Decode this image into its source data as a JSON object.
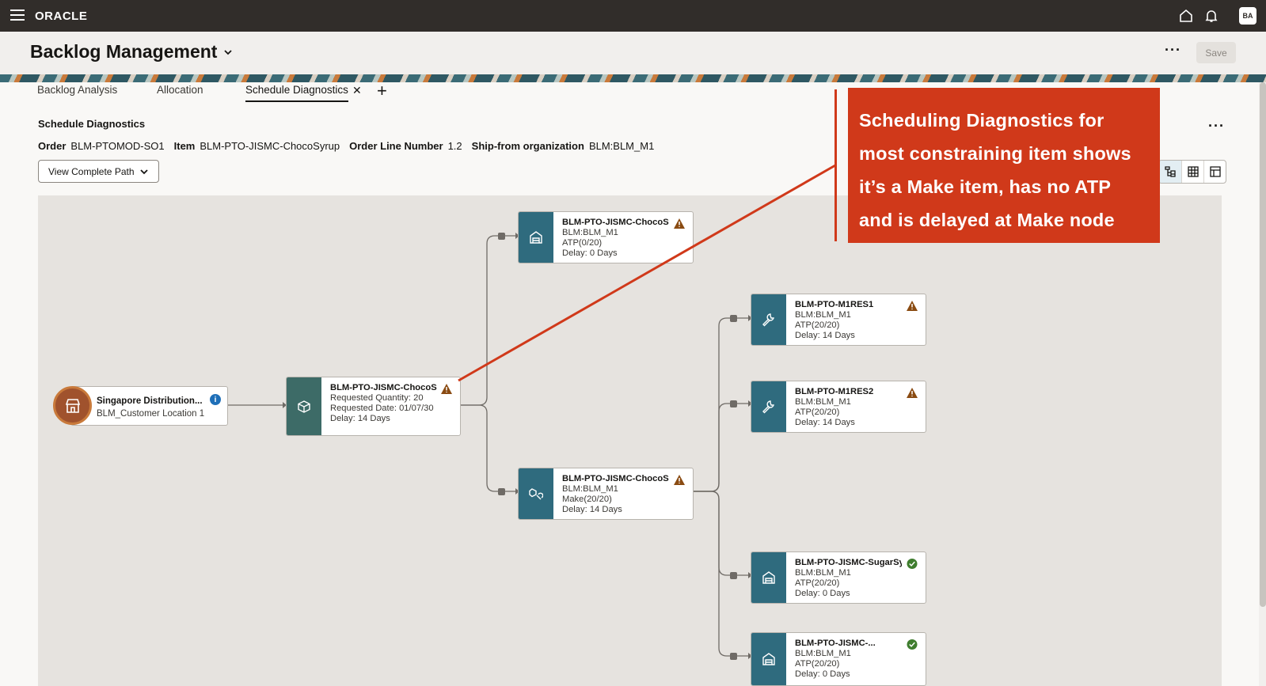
{
  "header": {
    "brand": "ORACLE",
    "avatar_initials": "BA"
  },
  "page": {
    "title": "Backlog Management",
    "save_label": "Save"
  },
  "tabs": [
    {
      "label": "Backlog Analysis"
    },
    {
      "label": "Allocation"
    },
    {
      "label": "Schedule Diagnostics"
    }
  ],
  "diagnostics": {
    "title": "Schedule Diagnostics",
    "order_label": "Order",
    "order_value": "BLM-PTOMOD-SO1",
    "item_label": "Item",
    "item_value": "BLM-PTO-JISMC-ChocoSyrup",
    "line_label": "Order Line Number",
    "line_value": "1.2",
    "org_label": "Ship-from organization",
    "org_value": "BLM:BLM_M1",
    "view_button": "View Complete Path"
  },
  "customer_node": {
    "name": "Singapore Distribution...",
    "location": "BLM_Customer Location 1"
  },
  "root_node": {
    "name": "BLM-PTO-JISMC-ChocoSyrup",
    "l1": "Requested Quantity: 20",
    "l2": "Requested Date: 01/07/30",
    "l3": "Delay: 14 Days",
    "status": "warning"
  },
  "nodes": [
    {
      "name": "BLM-PTO-JISMC-ChocoSyrup",
      "l1": "BLM:BLM_M1",
      "l2": "ATP(0/20)",
      "l3": "Delay: 0 Days",
      "status": "warning",
      "icon": "warehouse-icon"
    },
    {
      "name": "BLM-PTO-JISMC-ChocoSyrup",
      "l1": "BLM:BLM_M1",
      "l2": "Make(20/20)",
      "l3": "Delay: 14 Days",
      "status": "warning",
      "icon": "make-icon"
    },
    {
      "name": "BLM-PTO-M1RES1",
      "l1": "BLM:BLM_M1",
      "l2": "ATP(20/20)",
      "l3": "Delay: 14 Days",
      "status": "warning",
      "icon": "wrench-icon"
    },
    {
      "name": "BLM-PTO-M1RES2",
      "l1": "BLM:BLM_M1",
      "l2": "ATP(20/20)",
      "l3": "Delay: 14 Days",
      "status": "warning",
      "icon": "wrench-icon"
    },
    {
      "name": "BLM-PTO-JISMC-SugarSyrup",
      "l1": "BLM:BLM_M1",
      "l2": "ATP(20/20)",
      "l3": "Delay: 0 Days",
      "status": "ok",
      "icon": "warehouse-icon"
    },
    {
      "name": "BLM-PTO-JISMC-...",
      "l1": "BLM:BLM_M1",
      "l2": "ATP(20/20)",
      "l3": "Delay: 0 Days",
      "status": "ok",
      "icon": "warehouse-icon"
    }
  ],
  "callout": {
    "text": "Scheduling Diagnostics for most constraining item shows it’s a Make item, has no ATP and is delayed at Make node"
  },
  "colors": {
    "accent": "#d0391a",
    "tile": "#2f6b7e",
    "warning": "#8a4b12",
    "ok": "#3f7d2e"
  }
}
